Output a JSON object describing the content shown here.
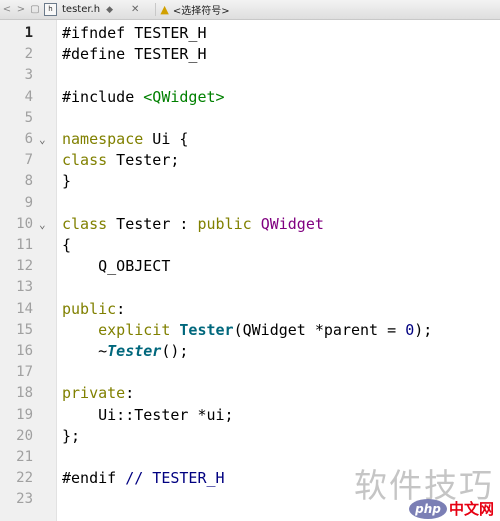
{
  "tabbar": {
    "nav_back": "<",
    "nav_forward": ">",
    "lock_icon": "lock-icon",
    "file_icon_label": "h",
    "file_name": "tester.h",
    "dropdown_glyph": "◆",
    "close_glyph": "✕",
    "symbol_selector": "<选择符号>"
  },
  "editor": {
    "current_line": 1,
    "lines": [
      {
        "n": "1",
        "html": "#ifndef TESTER_H"
      },
      {
        "n": "2",
        "html": "#define TESTER_H"
      },
      {
        "n": "3",
        "html": ""
      },
      {
        "n": "4",
        "html": "#include <span class=\"str\">&lt;QWidget&gt;</span>"
      },
      {
        "n": "5",
        "html": ""
      },
      {
        "n": "6",
        "fold": true,
        "html": "<span class=\"kw\">namespace</span> Ui {"
      },
      {
        "n": "7",
        "html": "<span class=\"kw\">class</span> Tester;"
      },
      {
        "n": "8",
        "html": "}"
      },
      {
        "n": "9",
        "html": ""
      },
      {
        "n": "10",
        "fold": true,
        "html": "<span class=\"kw\">class</span> Tester : <span class=\"kw\">public</span> <span class=\"ty\">QWidget</span>"
      },
      {
        "n": "11",
        "html": "{"
      },
      {
        "n": "12",
        "html": "    Q_OBJECT"
      },
      {
        "n": "13",
        "html": ""
      },
      {
        "n": "14",
        "html": "<span class=\"kw\">public</span>:"
      },
      {
        "n": "15",
        "html": "    <span class=\"kw\">explicit</span> <span class=\"fnb\">Tester</span>(QWidget *parent = <span class=\"num\">0</span>);"
      },
      {
        "n": "16",
        "html": "    ~<span class=\"fnbi\">Tester</span>();"
      },
      {
        "n": "17",
        "html": ""
      },
      {
        "n": "18",
        "html": "<span class=\"kw\">private</span>:"
      },
      {
        "n": "19",
        "html": "    Ui::Tester *ui;"
      },
      {
        "n": "20",
        "html": "};"
      },
      {
        "n": "21",
        "html": ""
      },
      {
        "n": "22",
        "html": "#endif <span class=\"com\">// TESTER_H</span>"
      },
      {
        "n": "23",
        "html": ""
      }
    ]
  },
  "watermark": {
    "text": "软件技巧",
    "logo_php": "php",
    "logo_cn": "中文网"
  }
}
